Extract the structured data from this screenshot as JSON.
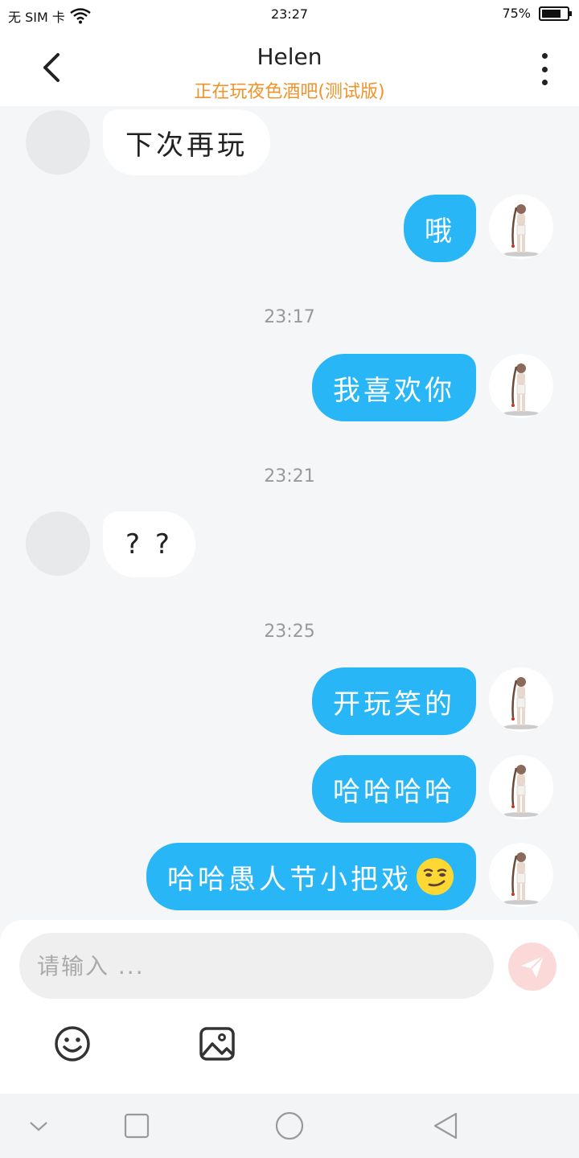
{
  "status_bar": {
    "carrier": "无 SIM 卡",
    "time": "23:27",
    "battery": "75%",
    "battery_level": 0.75
  },
  "header": {
    "title": "Helen",
    "subtitle": "正在玩夜色酒吧(测试版)"
  },
  "messages": [
    {
      "side": "in",
      "text": "下次再玩"
    },
    {
      "side": "out",
      "text": "哦"
    },
    {
      "type": "time",
      "text": "23:17"
    },
    {
      "side": "out",
      "text": "我喜欢你"
    },
    {
      "type": "time",
      "text": "23:21"
    },
    {
      "side": "in",
      "text": "? ?"
    },
    {
      "type": "time",
      "text": "23:25"
    },
    {
      "side": "out",
      "text": "开玩笑的"
    },
    {
      "side": "out",
      "text": "哈哈哈哈"
    },
    {
      "side": "out",
      "text": "哈哈愚人节小把戏",
      "emoji": "smirk-emoji"
    }
  ],
  "input": {
    "placeholder": "请输入 ..."
  },
  "icons": {
    "back": "chevron-left-icon",
    "more": "more-vertical-icon",
    "send": "send-icon",
    "emoji": "smiley-icon",
    "image": "image-icon",
    "nav_down": "chevron-down-icon",
    "nav_recent": "square-icon",
    "nav_home": "circle-icon",
    "nav_back": "triangle-back-icon"
  },
  "colors": {
    "accent": "#29b6f6",
    "subtitle": "#f0932b",
    "send_button": "#fbd9d9"
  }
}
